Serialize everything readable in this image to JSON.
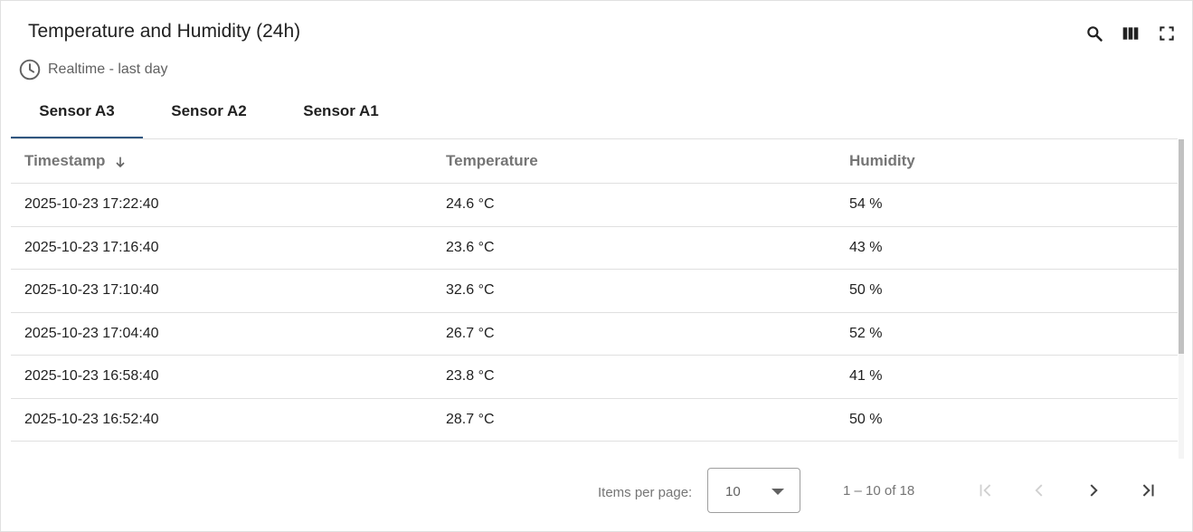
{
  "widget": {
    "title": "Temperature and Humidity (24h)",
    "subtitle": "Realtime - last day",
    "actions": [
      "search-icon",
      "columns-icon",
      "fullscreen-icon"
    ]
  },
  "tabs": [
    {
      "label": "Sensor A3",
      "active": true
    },
    {
      "label": "Sensor A2",
      "active": false
    },
    {
      "label": "Sensor A1",
      "active": false
    }
  ],
  "table": {
    "columns": [
      "Timestamp",
      "Temperature",
      "Humidity"
    ],
    "sort": {
      "column": "Timestamp",
      "direction": "descending"
    },
    "rows": [
      [
        "2025-10-23 17:22:40",
        "24.6 °C",
        "54 %"
      ],
      [
        "2025-10-23 17:16:40",
        "23.6 °C",
        "43 %"
      ],
      [
        "2025-10-23 17:10:40",
        "32.6 °C",
        "50 %"
      ],
      [
        "2025-10-23 17:04:40",
        "26.7 °C",
        "52 %"
      ],
      [
        "2025-10-23 16:58:40",
        "23.8 °C",
        "41 %"
      ],
      [
        "2025-10-23 16:52:40",
        "28.7 °C",
        "50 %"
      ]
    ]
  },
  "paginator": {
    "items_per_page_label": "Items per page:",
    "items_per_page": "10",
    "range_label": "1 – 10 of 18"
  },
  "colors": {
    "tab_indicator": "#305680",
    "border": "#e0e0e0",
    "muted_text": "#757575"
  }
}
